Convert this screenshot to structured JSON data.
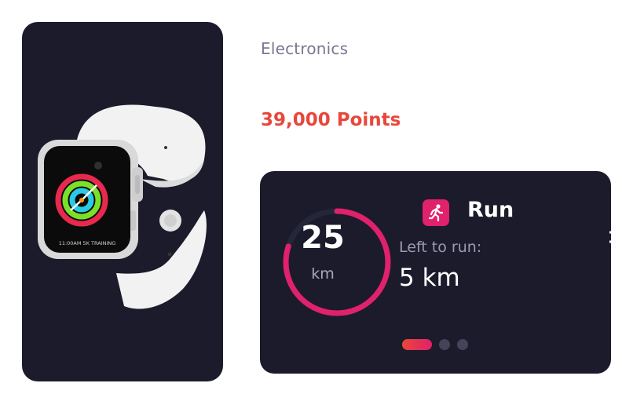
{
  "product": {
    "image_alt": "Apple Watch with white sport band",
    "watch_screen_text": "11:00AM 5K TRAINING"
  },
  "category": "Electronics",
  "points": "39,000 Points",
  "run_widget": {
    "title": "Run",
    "ring_value": "25",
    "ring_unit": "km",
    "progress_fraction": 0.8,
    "left_label": "Left to run:",
    "left_value": "5 km",
    "pager": {
      "count": 3,
      "active": 0
    }
  },
  "icons": {
    "run": "running-person-icon",
    "edge": "arrow-icon"
  },
  "colors": {
    "card_bg": "#1c1b2b",
    "points": "#e8473b",
    "accent": "#e0216b",
    "muted": "#7a7790"
  }
}
